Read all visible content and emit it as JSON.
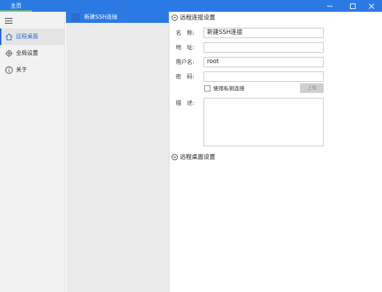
{
  "titlebar": {
    "tab_label": "主页",
    "accent_color": "#2b7ae4",
    "buttons": [
      "minimize-icon",
      "maximize-icon",
      "close-icon"
    ]
  },
  "sidebar": {
    "menu_icon": "hamburger-menu-icon",
    "items": [
      {
        "label": "远程桌面",
        "icon": "home-icon",
        "active": true
      },
      {
        "label": "全局设置",
        "icon": "gear-icon",
        "active": false
      },
      {
        "label": "关于",
        "icon": "info-icon",
        "active": false
      }
    ]
  },
  "connections": {
    "items": [
      {
        "label": "新建SSH连接",
        "selected": true
      }
    ]
  },
  "detail": {
    "connection_section": {
      "title": "远程连接设置",
      "expanded": true
    },
    "fields": {
      "name": {
        "label": "名　称:",
        "value": "新建SSH连接"
      },
      "address": {
        "label": "地　址:",
        "value": ""
      },
      "username": {
        "label": "用户名:",
        "value": "root"
      },
      "password": {
        "label": "密　码:",
        "value": ""
      }
    },
    "private_key": {
      "label": "使用私钥连接",
      "checked": false,
      "upload_label": "上传"
    },
    "description": {
      "label": "描　述:",
      "value": ""
    },
    "desktop_section": {
      "title": "远程桌面设置",
      "expanded": false
    }
  }
}
